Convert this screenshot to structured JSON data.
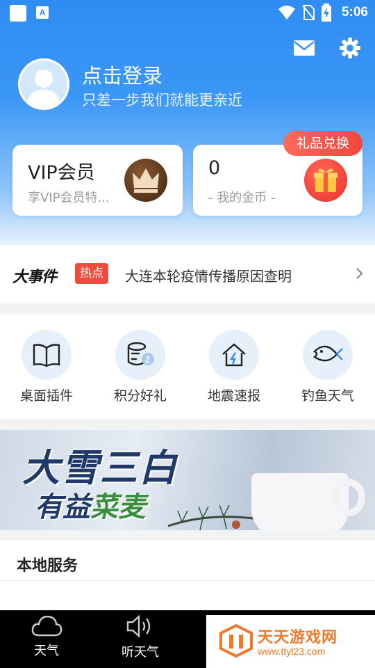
{
  "status_bar": {
    "time": "5:06",
    "app_icon_letter": "A"
  },
  "header": {
    "login_title": "点击登录",
    "login_subtitle": "只差一步我们就能更亲近"
  },
  "vip_card": {
    "title": "VIP会员",
    "subtitle": "享VIP会员特..."
  },
  "coin_card": {
    "count": "0",
    "subtitle": "- 我的金币 -",
    "badge": "礼品兑换"
  },
  "news": {
    "logo_text": "大事件",
    "tag": "热点",
    "headline": "大连本轮疫情传播原因查明"
  },
  "tools": [
    {
      "label": "桌面插件",
      "icon": "book-icon"
    },
    {
      "label": "积分好礼",
      "icon": "coins-icon"
    },
    {
      "label": "地震速报",
      "icon": "house-alert-icon"
    },
    {
      "label": "钓鱼天气",
      "icon": "fish-icon"
    }
  ],
  "banner": {
    "title": "大雪三白",
    "subtitle_a": "有益",
    "subtitle_b": "菜麦"
  },
  "local": {
    "title": "本地服务"
  },
  "bottom_nav": [
    {
      "label": "天气",
      "icon": "cloud-icon"
    },
    {
      "label": "听天气",
      "icon": "speaker-icon"
    }
  ],
  "watermark": {
    "title": "天天游戏网",
    "url": "www.ttyl23.com"
  },
  "colors": {
    "primary": "#2f8cf2",
    "accent_red": "#f04a3e",
    "watermark_orange": "#f07828"
  }
}
